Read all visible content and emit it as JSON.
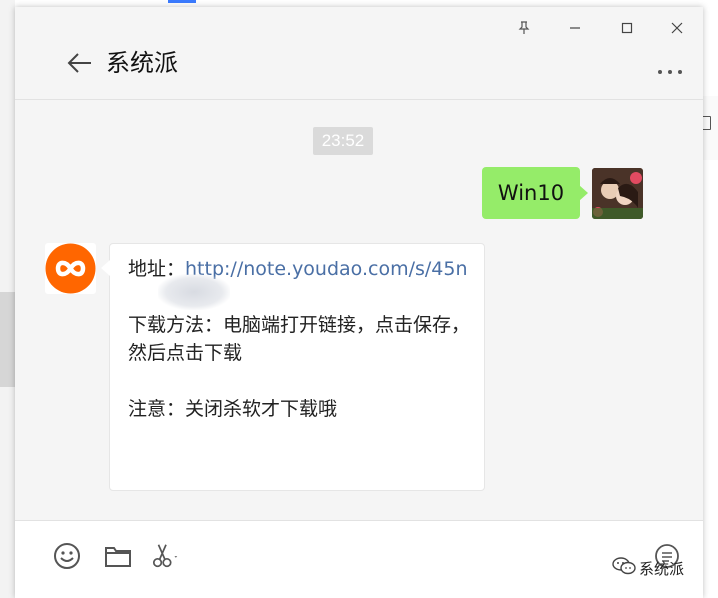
{
  "chat": {
    "title": "系统派"
  },
  "messages": {
    "timestamp": "23:52",
    "sent_text": "Win10",
    "received": {
      "address_label": "地址：",
      "address_link": "http://note.youdao.com/s/45n",
      "method": "下载方法：电脑端打开链接，点击保存，然后点击下载",
      "note": "注意：关闭杀软才下载哦"
    }
  },
  "watermark": {
    "text": "系统派"
  },
  "colors": {
    "sent_bubble": "#95ec69",
    "link": "#4a6fa5",
    "bot_avatar": "#ff6600"
  },
  "icons": [
    "pin-icon",
    "minimize-icon",
    "maximize-icon",
    "close-icon",
    "back-arrow-icon",
    "more-icon",
    "emoji-icon",
    "folder-icon",
    "scissors-icon",
    "chat-history-icon",
    "wechat-icon"
  ]
}
